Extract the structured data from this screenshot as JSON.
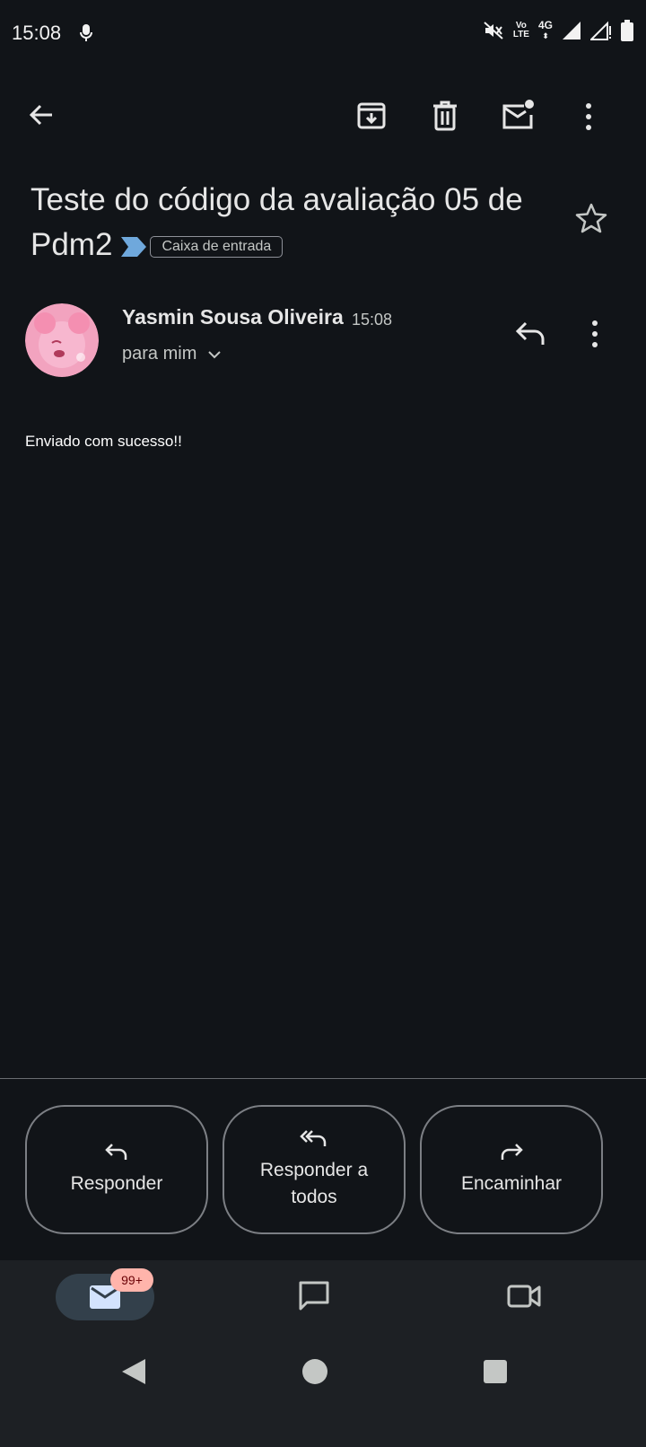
{
  "status_bar": {
    "time": "15:08",
    "volte_label": "Vo",
    "lte_label": "LTE",
    "network_label": "4G",
    "icons": [
      "mic-icon",
      "mute-icon",
      "signal-icon",
      "signal-icon",
      "battery-icon"
    ]
  },
  "toolbar": {
    "icons": [
      "back-arrow-icon",
      "archive-icon",
      "delete-icon",
      "mark-unread-icon",
      "more-vert-icon"
    ]
  },
  "email": {
    "subject": "Teste do código da avaliação 05 de Pdm2",
    "label": "Caixa de entrada",
    "sender_name": "Yasmin Sousa Oliveira",
    "time": "15:08",
    "recipients": "para mim",
    "body": "Enviado com sucesso!!"
  },
  "actions": {
    "reply": "Responder",
    "reply_all_line1": "Responder a",
    "reply_all_line2": "todos",
    "forward": "Encaminhar"
  },
  "bottom_nav": {
    "mail_badge": "99+",
    "icons": [
      "mail-icon",
      "chat-icon",
      "meet-icon"
    ]
  },
  "colors": {
    "background": "#111418",
    "label_arrow": "#6fa8dc",
    "badge": "#ffb4ab",
    "nav_background": "#1d2024"
  }
}
